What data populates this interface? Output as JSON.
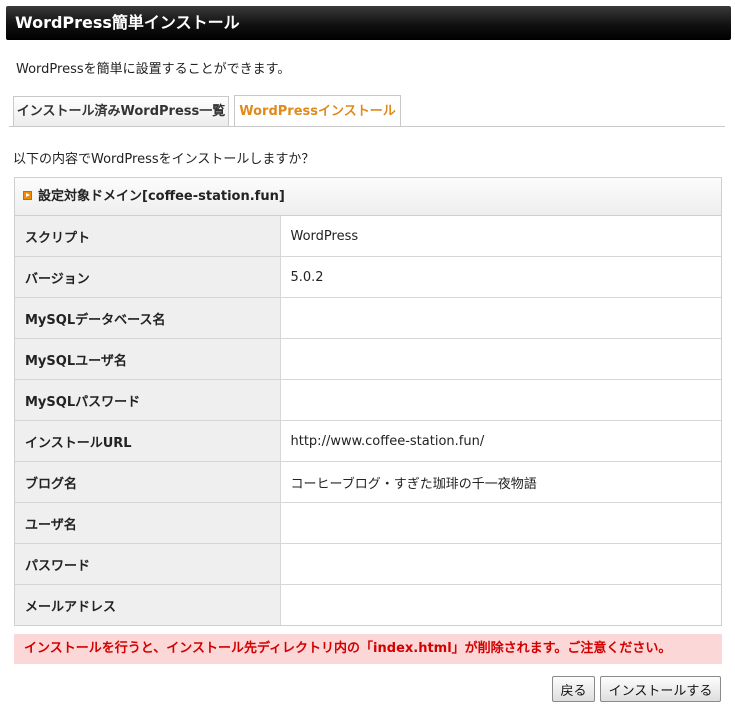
{
  "header": {
    "title": "WordPress簡単インストール"
  },
  "intro": "WordPressを簡単に設置することができます。",
  "tabs": [
    {
      "label": "インストール済みWordPress一覧",
      "active": false
    },
    {
      "label": "WordPressインストール",
      "active": true
    }
  ],
  "question": "以下の内容でWordPressをインストールしますか？",
  "panel": {
    "title": "設定対象ドメイン[coffee-station.fun]",
    "rows": [
      {
        "key": "スクリプト",
        "value": "WordPress"
      },
      {
        "key": "バージョン",
        "value": "5.0.2"
      },
      {
        "key": "MySQLデータベース名",
        "value": ""
      },
      {
        "key": "MySQLユーザ名",
        "value": ""
      },
      {
        "key": "MySQLパスワード",
        "value": ""
      },
      {
        "key": "インストールURL",
        "value": "http://www.coffee-station.fun/"
      },
      {
        "key": "ブログ名",
        "value": "コーヒーブログ・すぎた珈琲の千一夜物語"
      },
      {
        "key": "ユーザ名",
        "value": ""
      },
      {
        "key": "パスワード",
        "value": ""
      },
      {
        "key": "メールアドレス",
        "value": ""
      }
    ]
  },
  "warning": "インストールを行うと、インストール先ディレクトリ内の「index.html」が削除されます。ご注意ください。",
  "buttons": {
    "back": "戻る",
    "install": "インストールする"
  },
  "colors": {
    "accent": "#e08a19",
    "warning_bg": "#fcd7d7",
    "warning_text": "#d40000",
    "header_bg": "#111111"
  }
}
